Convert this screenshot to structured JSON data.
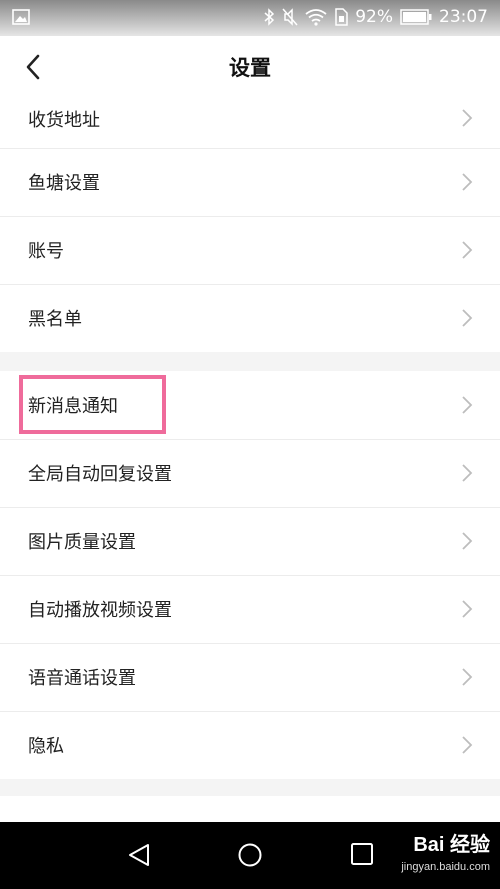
{
  "status_bar": {
    "battery_percent": "92%",
    "time": "23:07",
    "icons": [
      "image-icon",
      "bluetooth-icon",
      "mute-icon",
      "wifi-icon",
      "sim-icon",
      "battery-icon"
    ]
  },
  "header": {
    "title": "设置"
  },
  "settings": {
    "group1": [
      {
        "label": "收货地址"
      },
      {
        "label": "鱼塘设置"
      },
      {
        "label": "账号"
      },
      {
        "label": "黑名单"
      }
    ],
    "group2": [
      {
        "label": "新消息通知"
      },
      {
        "label": "全局自动回复设置"
      },
      {
        "label": "图片质量设置"
      },
      {
        "label": "自动播放视频设置"
      },
      {
        "label": "语音通话设置"
      },
      {
        "label": "隐私"
      }
    ]
  },
  "annotation": {
    "highlight_color": "#ef6b9b"
  },
  "watermark": {
    "logo": "Bai 经验",
    "url": "jingyan.baidu.com"
  }
}
